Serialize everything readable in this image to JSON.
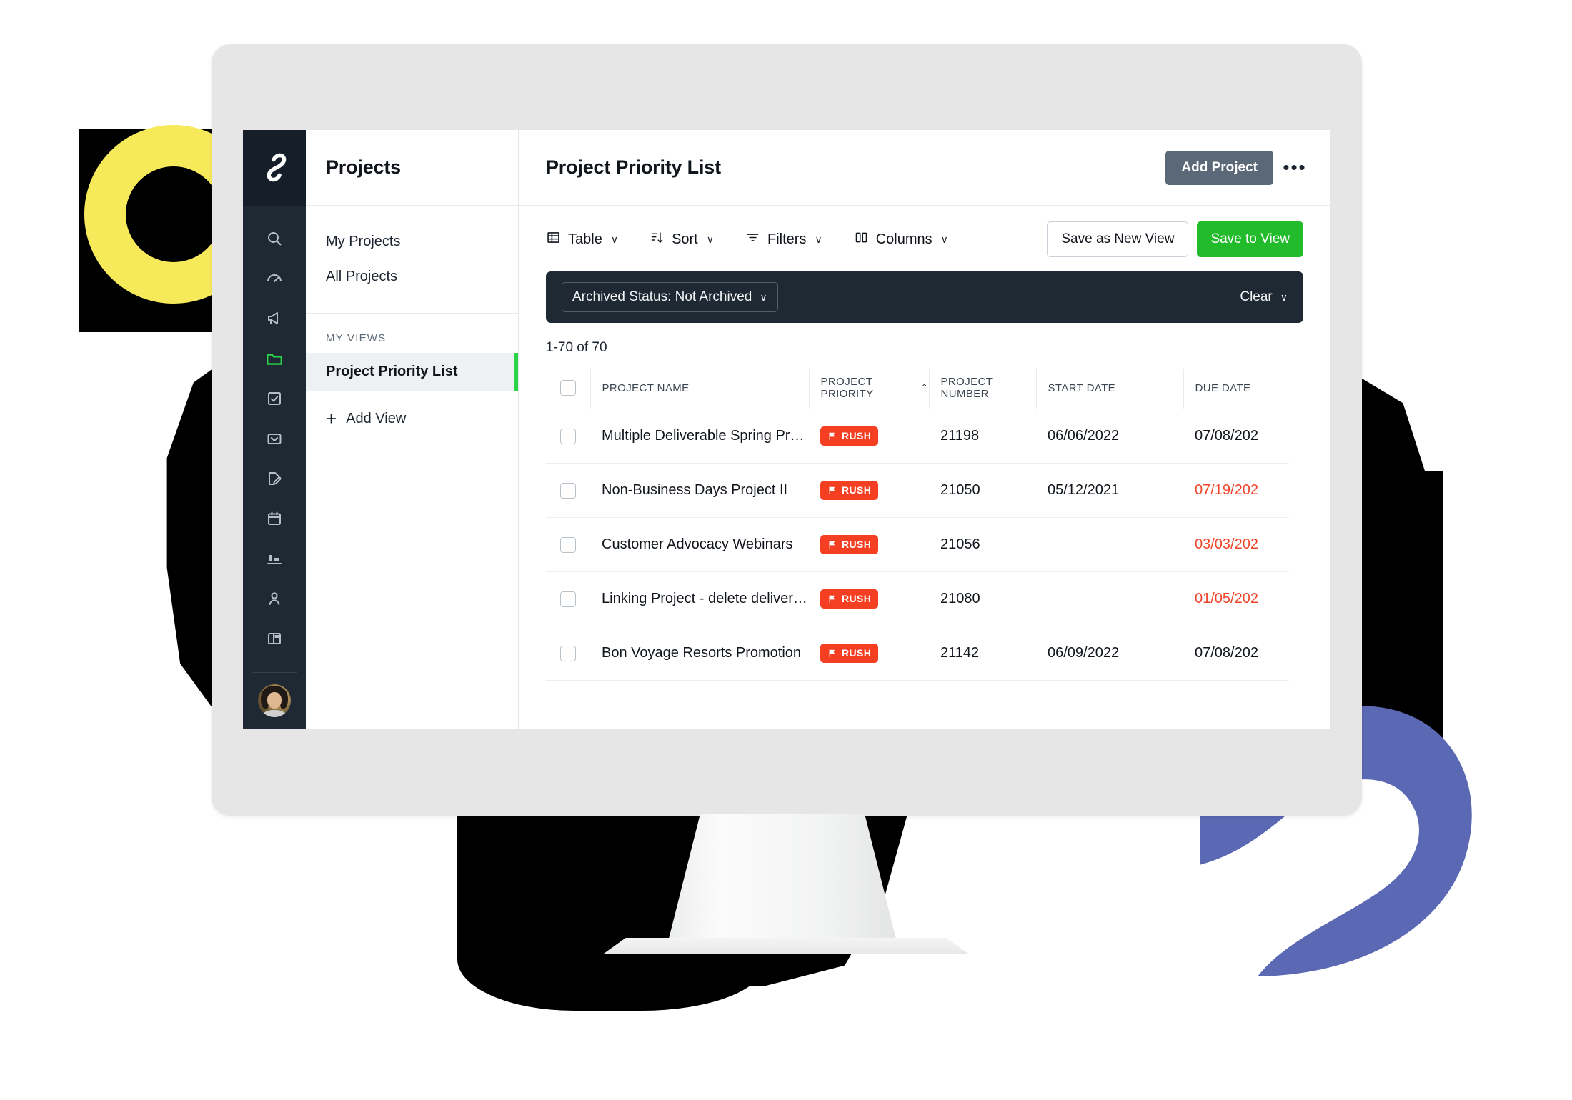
{
  "decor": {
    "yellow": "#f7ea5a",
    "purple": "#5b68b4",
    "black": "#000000"
  },
  "app": {
    "logo_icon": "infinity-logo-icon",
    "rail_icons": [
      {
        "name": "search-icon",
        "active": false
      },
      {
        "name": "dashboard-gauge-icon",
        "active": false
      },
      {
        "name": "megaphone-icon",
        "active": false
      },
      {
        "name": "folder-icon",
        "active": true
      },
      {
        "name": "task-checkbox-icon",
        "active": false
      },
      {
        "name": "inbox-icon",
        "active": false
      },
      {
        "name": "document-edit-icon",
        "active": false
      },
      {
        "name": "calendar-icon",
        "active": false
      },
      {
        "name": "reports-bar-icon",
        "active": false
      },
      {
        "name": "person-icon",
        "active": false
      },
      {
        "name": "board-layout-icon",
        "active": false
      }
    ],
    "avatar_label": "user-avatar"
  },
  "sidebar": {
    "title": "Projects",
    "items": [
      {
        "label": "My Projects"
      },
      {
        "label": "All Projects"
      }
    ],
    "section_label": "MY VIEWS",
    "views": [
      {
        "label": "Project Priority List",
        "active": true
      }
    ],
    "add_view": "Add View",
    "add_view_plus": "+",
    "active_accent": "#2cd44a"
  },
  "header": {
    "title": "Project Priority List",
    "add_project": "Add Project",
    "more_menu": "•••"
  },
  "toolbar": {
    "items": [
      {
        "label": "Table",
        "icon": "table-icon",
        "chevron": "∨"
      },
      {
        "label": "Sort",
        "icon": "sort-icon",
        "chevron": "∨"
      },
      {
        "label": "Filters",
        "icon": "filter-icon",
        "chevron": "∨"
      },
      {
        "label": "Columns",
        "icon": "columns-icon",
        "chevron": "∨"
      }
    ],
    "save_as_new_view": "Save as New View",
    "save_to_view": "Save to View",
    "save_to_view_color": "#22bb2b"
  },
  "filter_bar": {
    "chip_label": "Archived Status: Not Archived",
    "chip_chevron": "∨",
    "clear_label": "Clear",
    "clear_chevron": "∨",
    "background": "#1f2933"
  },
  "results": {
    "count_text": "1-70 of 70"
  },
  "table": {
    "columns": [
      {
        "key": "check",
        "label": ""
      },
      {
        "key": "name",
        "label": "PROJECT NAME"
      },
      {
        "key": "priority",
        "label": "PROJECT PRIORITY",
        "sort": "⌃"
      },
      {
        "key": "number",
        "label": "PROJECT NUMBER"
      },
      {
        "key": "start",
        "label": "START DATE"
      },
      {
        "key": "due",
        "label": "DUE DATE"
      }
    ],
    "badge_label": "RUSH",
    "badge_color": "#f43f23",
    "overdue_color": "#f0452a",
    "rows": [
      {
        "name": "Multiple Deliverable Spring Promoti...",
        "priority": "RUSH",
        "number": "21198",
        "start": "06/06/2022",
        "due": "07/08/202",
        "overdue": false
      },
      {
        "name": "Non-Business Days Project II",
        "priority": "RUSH",
        "number": "21050",
        "start": "05/12/2021",
        "due": "07/19/202",
        "overdue": true
      },
      {
        "name": "Customer Advocacy Webinars",
        "priority": "RUSH",
        "number": "21056",
        "start": "",
        "due": "03/03/202",
        "overdue": true
      },
      {
        "name": "Linking Project - delete deliverable",
        "priority": "RUSH",
        "number": "21080",
        "start": "",
        "due": "01/05/202",
        "overdue": true
      },
      {
        "name": "Bon Voyage Resorts Promotion",
        "priority": "RUSH",
        "number": "21142",
        "start": "06/09/2022",
        "due": "07/08/202",
        "overdue": false
      }
    ]
  }
}
